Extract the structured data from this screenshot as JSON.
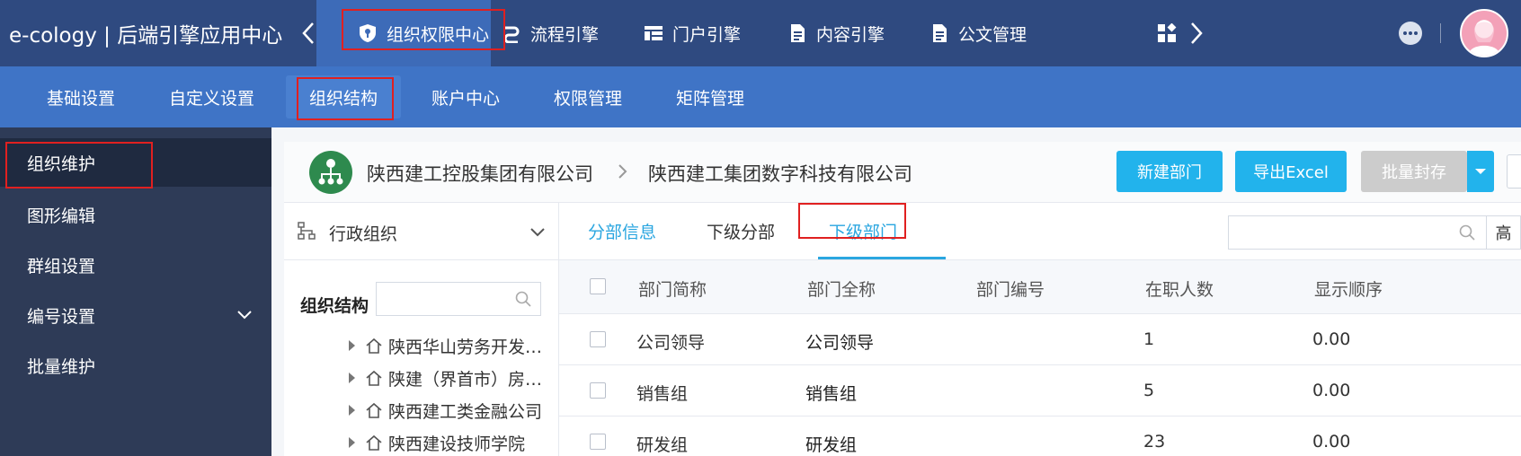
{
  "topbar": {
    "brand": "e-cology | 后端引擎应用中心",
    "nav": [
      {
        "label": "组织权限中心",
        "icon": "shield-key-icon"
      },
      {
        "label": "流程引擎",
        "icon": "flow-icon"
      },
      {
        "label": "门户引擎",
        "icon": "portal-icon"
      },
      {
        "label": "内容引擎",
        "icon": "document-icon"
      },
      {
        "label": "公文管理",
        "icon": "document-icon"
      }
    ]
  },
  "subnav": {
    "items": [
      "基础设置",
      "自定义设置",
      "组织结构",
      "账户中心",
      "权限管理",
      "矩阵管理"
    ]
  },
  "sidebar": {
    "items": [
      "组织维护",
      "图形编辑",
      "群组设置",
      "编号设置",
      "批量维护"
    ]
  },
  "header": {
    "crumb_parent": "陕西建工控股集团有限公司",
    "crumb_current": "陕西建工集团数字科技有限公司",
    "btn_new_dept": "新建部门",
    "btn_export": "导出Excel",
    "btn_batch_archive": "批量封存"
  },
  "tree": {
    "selector_label": "行政组织",
    "title": "组织结构",
    "nodes": [
      "陕西华山劳务开发集团有限公司",
      "陕建（界首市）房地产开发有限公司",
      "陕西建工类金融公司",
      "陕西建设技师学院"
    ]
  },
  "tabs": {
    "items": [
      "分部信息",
      "下级分部",
      "下级部门"
    ],
    "advanced": "高"
  },
  "table": {
    "columns": [
      "部门简称",
      "部门全称",
      "部门编号",
      "在职人数",
      "显示顺序"
    ],
    "rows": [
      {
        "short": "公司领导",
        "full": "公司领导",
        "code": "",
        "count": "1",
        "order": "0.00"
      },
      {
        "short": "销售组",
        "full": "销售组",
        "code": "",
        "count": "5",
        "order": "0.00"
      },
      {
        "short": "研发组",
        "full": "研发组",
        "code": "",
        "count": "23",
        "order": "0.00"
      }
    ]
  },
  "colors": {
    "topbar": "#2f4a80",
    "subnav": "#3f74c6",
    "sidebar": "#2e3b57",
    "accent": "#22b3ec",
    "highlight": "#e02020"
  }
}
